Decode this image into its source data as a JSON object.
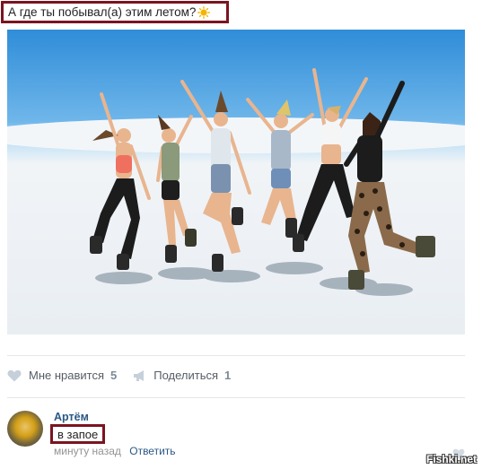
{
  "post": {
    "title": "А где ты побывал(а) этим летом?",
    "emoji_icon": "sun-icon"
  },
  "actions": {
    "like_label": "Мне нравится",
    "like_count": "5",
    "share_label": "Поделиться",
    "share_count": "1"
  },
  "comment": {
    "author": "Артём",
    "text": "в запое",
    "time": "минуту назад",
    "reply_label": "Ответить"
  },
  "watermark": "Fishki.net",
  "colors": {
    "highlight_border": "#7a1520",
    "link": "#2a5885",
    "muted": "#939393"
  }
}
